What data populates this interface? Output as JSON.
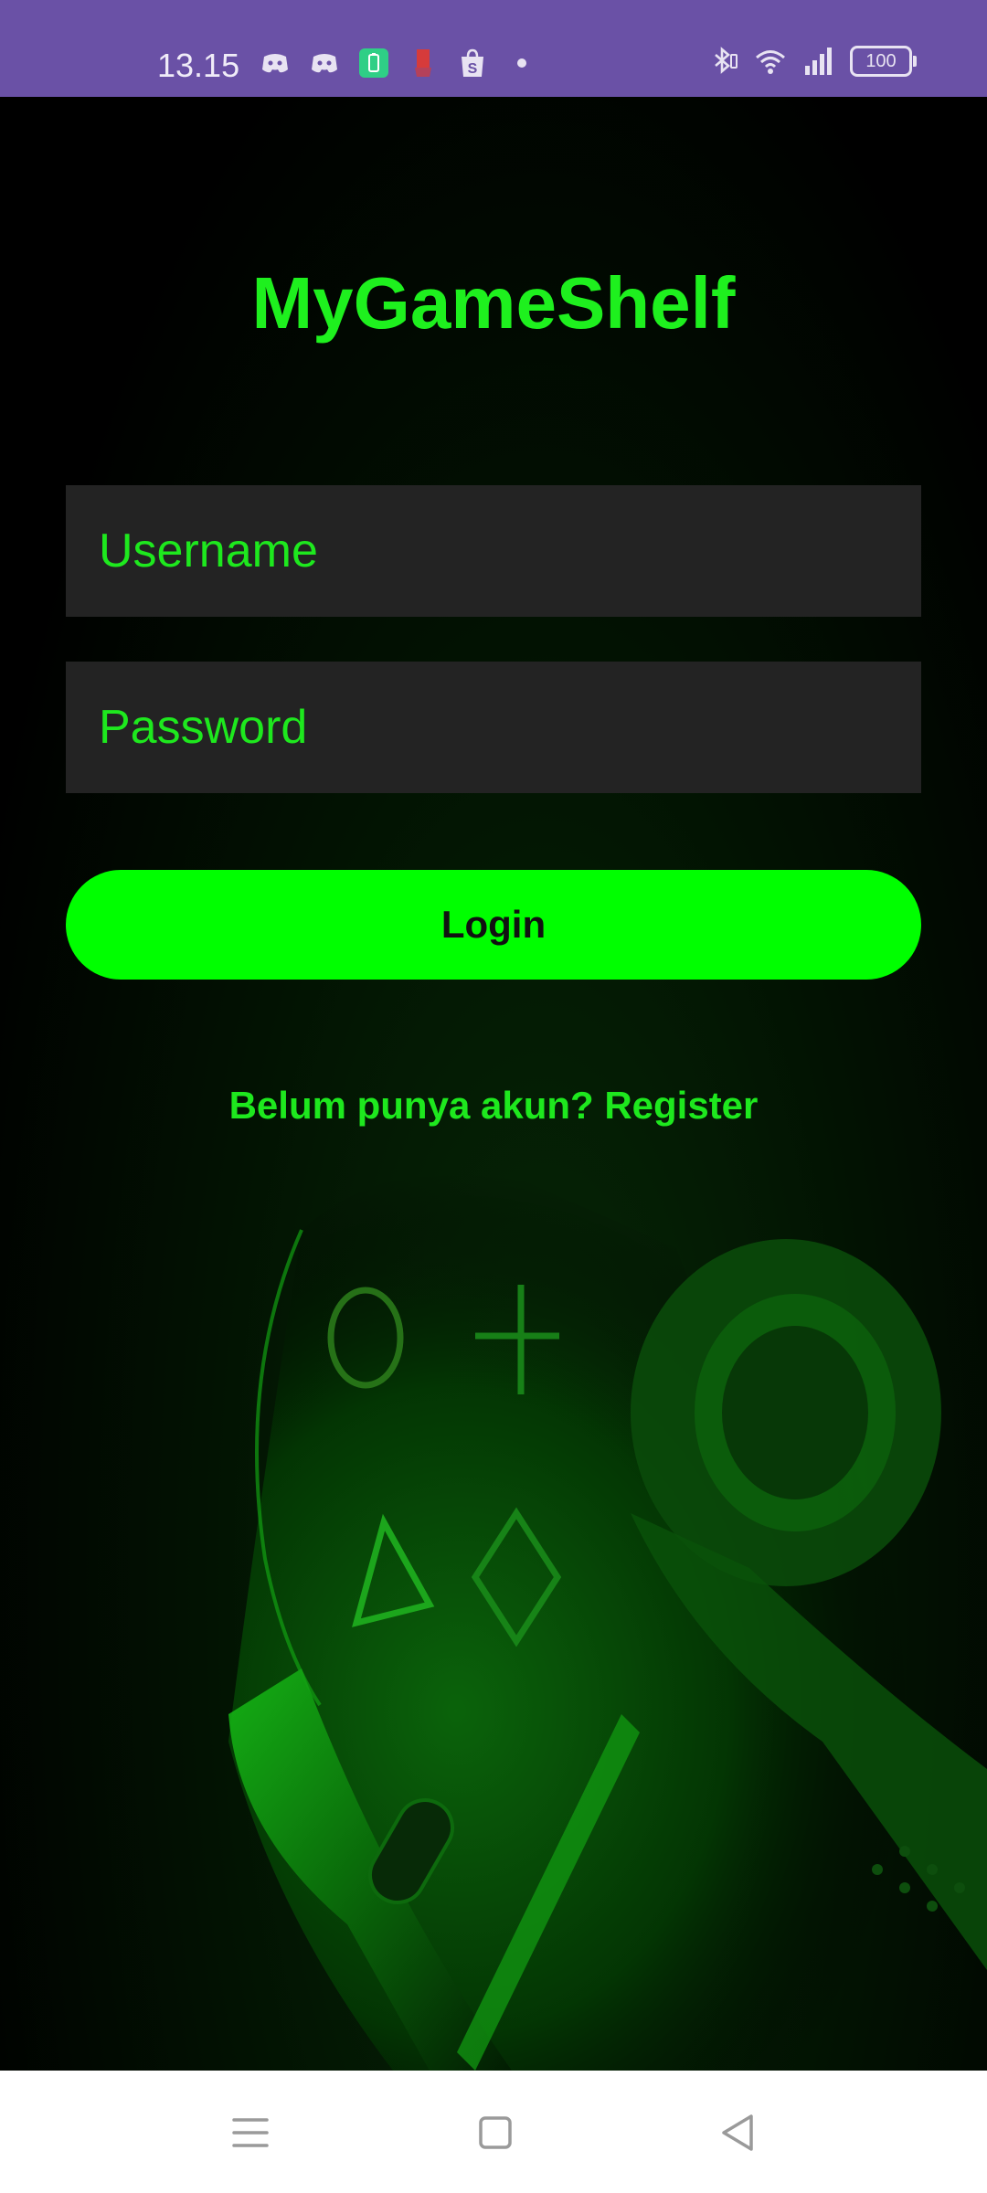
{
  "status_bar": {
    "time": "13.15",
    "battery": "100",
    "color": "#6a51a6",
    "left_icons": [
      "discord-icon",
      "discord-icon",
      "battery-saver-icon",
      "notification-icon",
      "shopee-icon",
      "dot-icon"
    ],
    "right_icons": [
      "bluetooth-icon",
      "wifi-icon",
      "signal-icon",
      "battery-icon"
    ]
  },
  "app": {
    "title": "MyGameShelf",
    "accent_color": "#00ff00",
    "username": {
      "placeholder": "Username",
      "value": ""
    },
    "password": {
      "placeholder": "Password",
      "value": ""
    },
    "login_label": "Login",
    "register_link": "Belum punya akun? Register",
    "background": "game-controller-image"
  },
  "nav_bar": {
    "buttons": [
      "menu-icon",
      "home-icon",
      "back-icon"
    ]
  }
}
